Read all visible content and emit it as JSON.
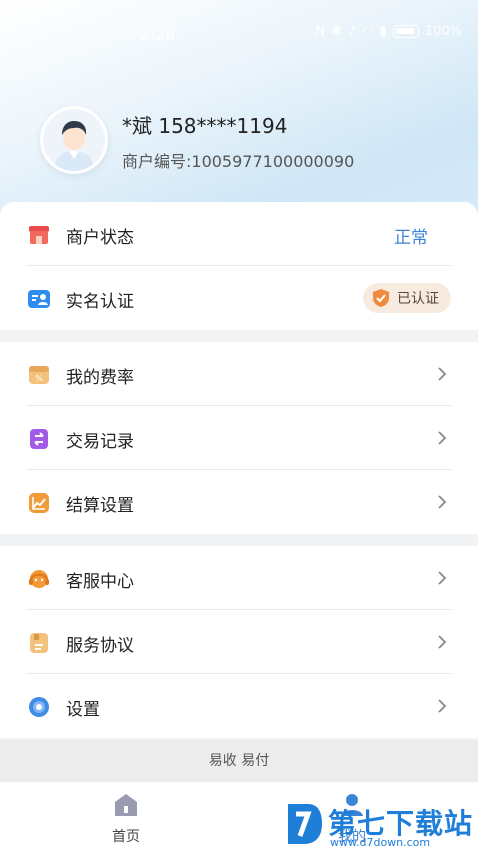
{
  "status_bar": {
    "time": "2:26",
    "battery": "100%"
  },
  "profile": {
    "name": "*斌  158****1194",
    "merchant_no": "商户编号:1005977100000090"
  },
  "section1": {
    "merchant_status": {
      "label": "商户状态",
      "value": "正常"
    },
    "real_name": {
      "label": "实名认证",
      "badge": "已认证"
    }
  },
  "section2": {
    "items": [
      {
        "label": "我的费率"
      },
      {
        "label": "交易记录"
      },
      {
        "label": "结算设置"
      }
    ]
  },
  "section3": {
    "items": [
      {
        "label": "客服中心"
      },
      {
        "label": "服务协议"
      },
      {
        "label": "设置"
      }
    ]
  },
  "footer": {
    "brand": "易收 易付"
  },
  "tabbar": {
    "home": "首页",
    "mine": "我的"
  },
  "watermark": {
    "text": "第七下载站",
    "url": "www.d7down.com"
  },
  "colors": {
    "accent": "#3e83d6",
    "badge_bg": "#f7ebdf",
    "badge_icon": "#f08a3e"
  }
}
